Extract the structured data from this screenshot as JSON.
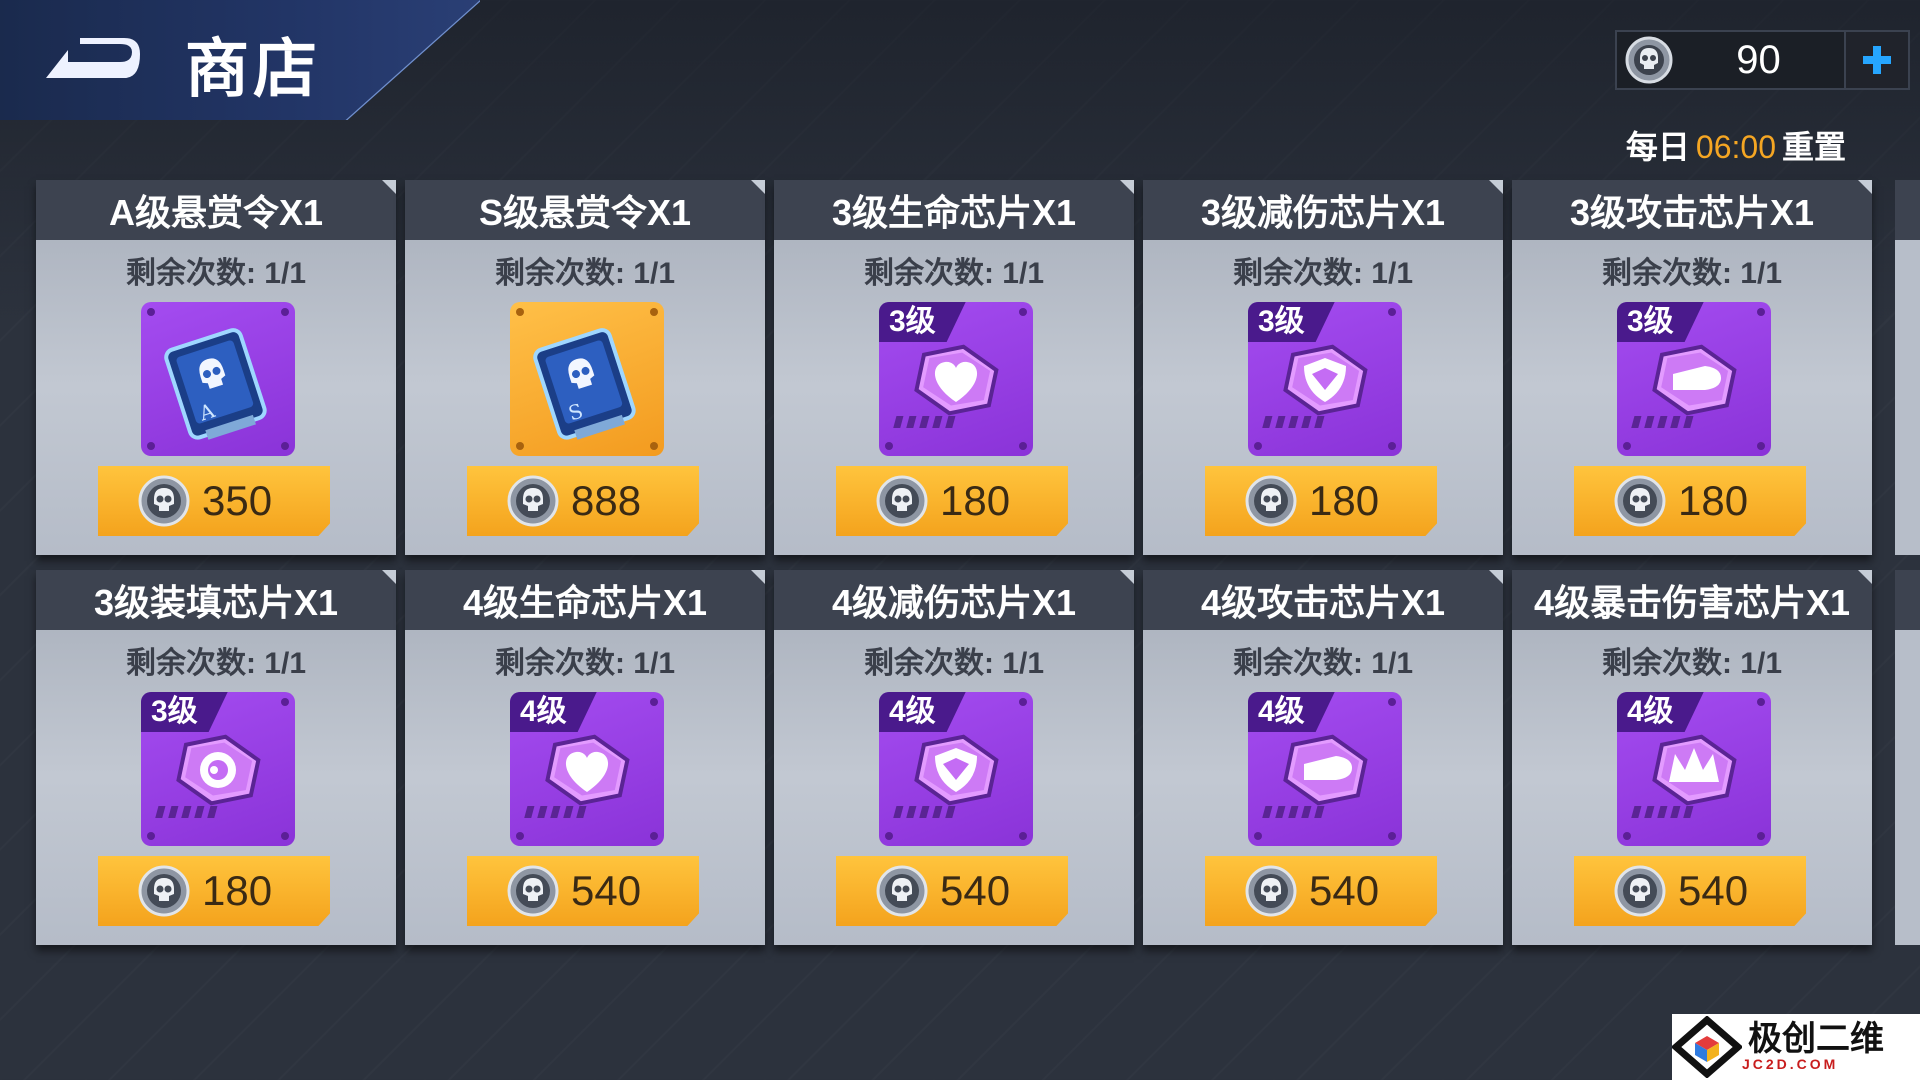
{
  "header": {
    "title": "商店"
  },
  "currency": {
    "value": "90"
  },
  "reset": {
    "prefix": "每日",
    "time": "06:00",
    "suffix": "重置"
  },
  "cards": [
    {
      "title": "A级悬赏令X1",
      "count": "剩余次数: 1/1",
      "price": "350",
      "icon": "bounty-card-a-icon",
      "level": ""
    },
    {
      "title": "S级悬赏令X1",
      "count": "剩余次数: 1/1",
      "price": "888",
      "icon": "bounty-card-s-icon",
      "level": ""
    },
    {
      "title": "3级生命芯片X1",
      "count": "剩余次数: 1/1",
      "price": "180",
      "icon": "heart-chip-icon",
      "level": "3级"
    },
    {
      "title": "3级减伤芯片X1",
      "count": "剩余次数: 1/1",
      "price": "180",
      "icon": "shield-chip-icon",
      "level": "3级"
    },
    {
      "title": "3级攻击芯片X1",
      "count": "剩余次数: 1/1",
      "price": "180",
      "icon": "bullet-chip-icon",
      "level": "3级"
    },
    {
      "title": "3级装填芯片X1",
      "count": "剩余次数: 1/1",
      "price": "180",
      "icon": "reload-chip-icon",
      "level": "3级"
    },
    {
      "title": "4级生命芯片X1",
      "count": "剩余次数: 1/1",
      "price": "540",
      "icon": "heart-chip-icon",
      "level": "4级"
    },
    {
      "title": "4级减伤芯片X1",
      "count": "剩余次数: 1/1",
      "price": "540",
      "icon": "shield-chip-icon",
      "level": "4级"
    },
    {
      "title": "4级攻击芯片X1",
      "count": "剩余次数: 1/1",
      "price": "540",
      "icon": "bullet-chip-icon",
      "level": "4级"
    },
    {
      "title": "4级暴击伤害芯片X1",
      "count": "剩余次数: 1/1",
      "price": "540",
      "icon": "crit-chip-icon",
      "level": "4级"
    }
  ],
  "watermark": {
    "name": "极创二维",
    "site": "JC2D.COM"
  },
  "colors": {
    "accent": "#f5a623",
    "item_purple": "#9b42e8",
    "item_gold": "#f7ab2c",
    "header_blue": "#223566"
  }
}
